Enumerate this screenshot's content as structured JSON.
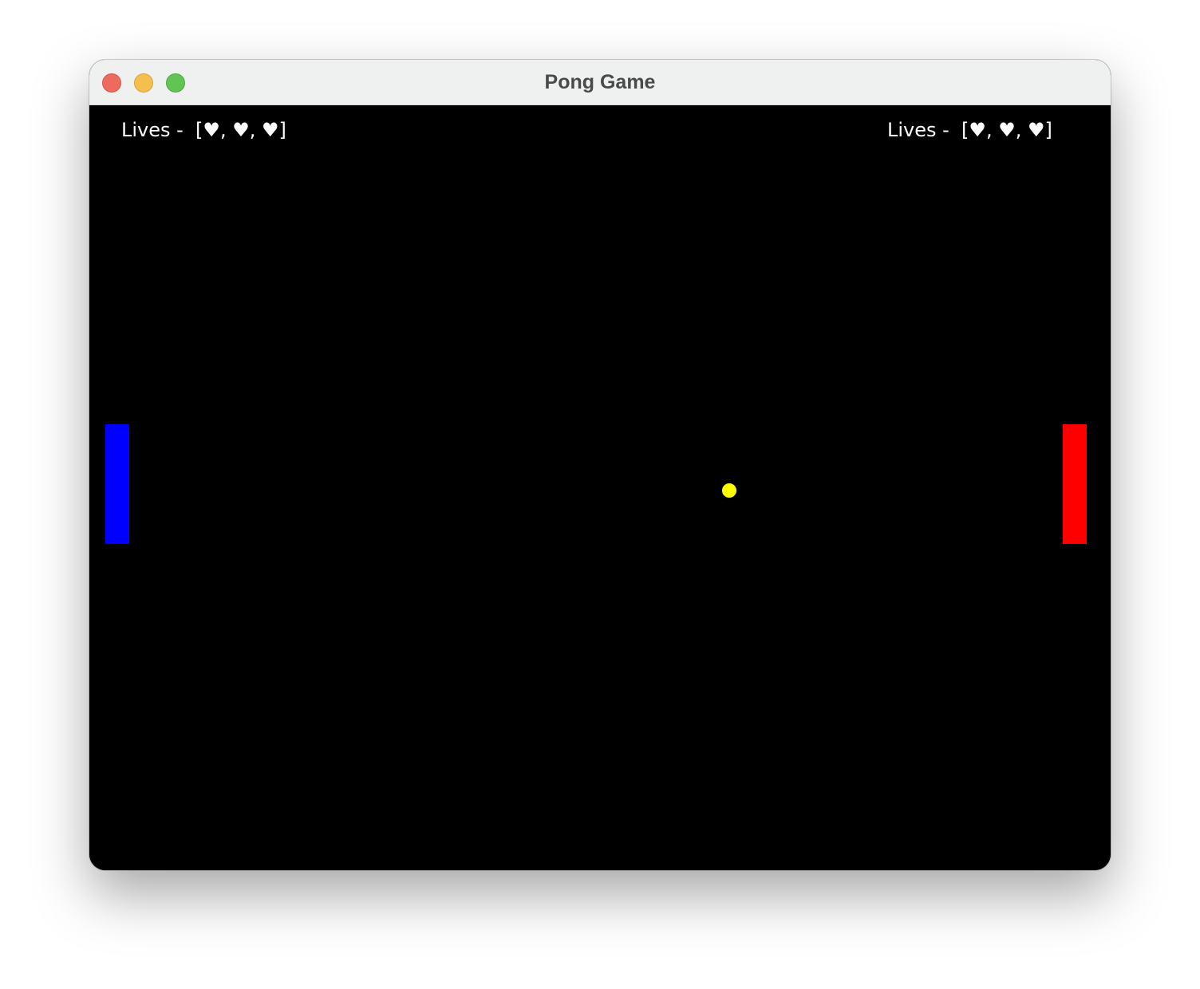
{
  "window": {
    "title": "Pong Game"
  },
  "players": {
    "left": {
      "lives_text": "Lives -  [♥, ♥, ♥]",
      "lives": 3,
      "paddle_color": "#0000ff"
    },
    "right": {
      "lives_text": "Lives -  [♥, ♥, ♥]",
      "lives": 3,
      "paddle_color": "#ff0000"
    }
  },
  "ball": {
    "color": "#ffff00"
  },
  "colors": {
    "background": "#000000",
    "text": "#ffffff"
  }
}
